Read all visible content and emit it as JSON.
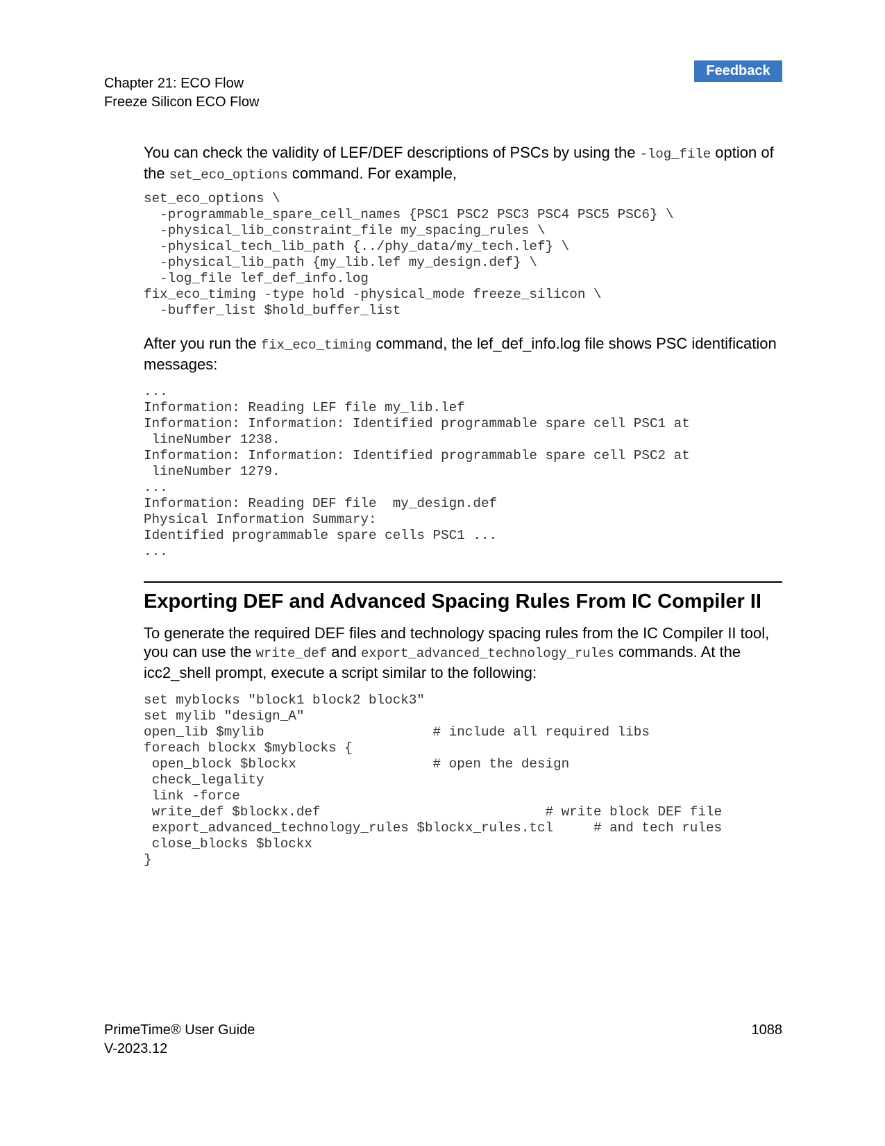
{
  "feedback_label": "Feedback",
  "header": {
    "chapter": "Chapter 21: ECO Flow",
    "section": "Freeze Silicon ECO Flow"
  },
  "para1": {
    "t1": "You can check the validity of LEF/DEF descriptions of PSCs by using the ",
    "c1": "-log_file",
    "t2": " option of the ",
    "c2": "set_eco_options",
    "t3": " command. For example,"
  },
  "code1": "set_eco_options \\\n  -programmable_spare_cell_names {PSC1 PSC2 PSC3 PSC4 PSC5 PSC6} \\\n  -physical_lib_constraint_file my_spacing_rules \\\n  -physical_tech_lib_path {../phy_data/my_tech.lef} \\\n  -physical_lib_path {my_lib.lef my_design.def} \\\n  -log_file lef_def_info.log\nfix_eco_timing -type hold -physical_mode freeze_silicon \\\n  -buffer_list $hold_buffer_list",
  "para2": {
    "t1": "After you run the ",
    "c1": "fix_eco_timing",
    "t2": " command, the lef_def_info.log file shows PSC identification messages:"
  },
  "code2": "...\nInformation: Reading LEF file my_lib.lef\nInformation: Information: Identified programmable spare cell PSC1 at\n lineNumber 1238.\nInformation: Information: Identified programmable spare cell PSC2 at\n lineNumber 1279.\n...\nInformation: Reading DEF file  my_design.def\nPhysical Information Summary:\nIdentified programmable spare cells PSC1 ...\n...",
  "section_title": "Exporting DEF and Advanced Spacing Rules From IC Compiler II",
  "para3": {
    "t1": "To generate the required DEF files and technology spacing rules from the IC Compiler II tool, you can use the ",
    "c1": "write_def",
    "t2": " and ",
    "c2": "export_advanced_technology_rules",
    "t3": " commands. At the icc2_shell prompt, execute a script similar to the following:"
  },
  "code3": "set myblocks \"block1 block2 block3\"\nset mylib \"design_A\"\nopen_lib $mylib                     # include all required libs\nforeach blockx $myblocks {\n open_block $blockx                 # open the design\n check_legality\n link -force\n write_def $blockx.def                            # write block DEF file\n export_advanced_technology_rules $blockx_rules.tcl     # and tech rules\n close_blocks $blockx\n}",
  "footer": {
    "title": "PrimeTime® User Guide",
    "version": "V-2023.12",
    "page": "1088"
  }
}
